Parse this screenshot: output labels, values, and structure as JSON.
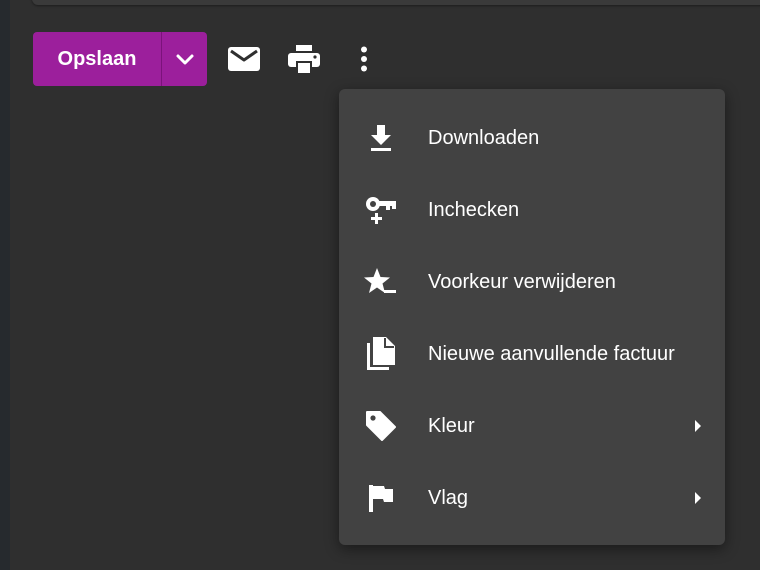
{
  "toolbar": {
    "save_label": "Opslaan",
    "accent_color": "#9c1f9c",
    "icons": [
      "chevron-down-icon",
      "mail-icon",
      "print-icon",
      "more-vert-icon"
    ]
  },
  "menu": {
    "items": [
      {
        "label": "Downloaden",
        "icon": "download-icon",
        "has_submenu": false
      },
      {
        "label": "Inchecken",
        "icon": "key-plus-icon",
        "has_submenu": false
      },
      {
        "label": "Voorkeur verwijderen",
        "icon": "star-remove-icon",
        "has_submenu": false
      },
      {
        "label": "Nieuwe aanvullende factuur",
        "icon": "file-copy-icon",
        "has_submenu": false
      },
      {
        "label": "Kleur",
        "icon": "tag-icon",
        "has_submenu": true
      },
      {
        "label": "Vlag",
        "icon": "flag-icon",
        "has_submenu": true
      }
    ]
  }
}
